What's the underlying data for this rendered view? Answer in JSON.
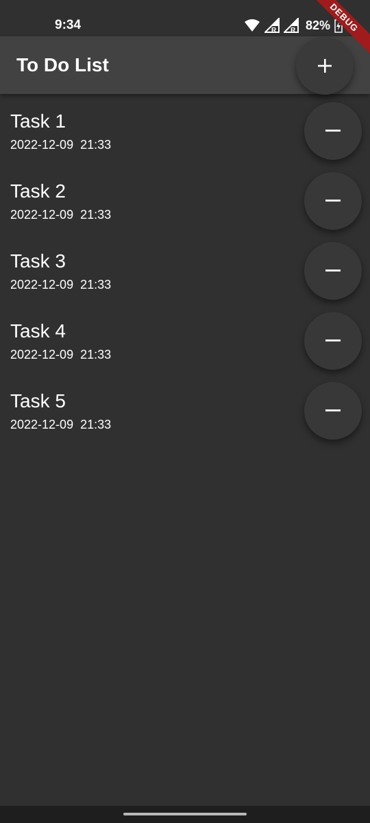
{
  "status_bar": {
    "time": "9:34",
    "battery": "82%",
    "icons": [
      "wifi-icon",
      "signal-r-icon",
      "signal-r-icon",
      "battery-charging-icon"
    ]
  },
  "debug_banner": "DEBUG",
  "app_bar": {
    "title": "To Do List",
    "add_button_icon": "plus-icon"
  },
  "tasks": [
    {
      "title": "Task 1",
      "date": "2022-12-09",
      "time": "21:33",
      "meta": "2022-12-09  21:33"
    },
    {
      "title": "Task 2",
      "date": "2022-12-09",
      "time": "21:33",
      "meta": "2022-12-09  21:33"
    },
    {
      "title": "Task 3",
      "date": "2022-12-09",
      "time": "21:33",
      "meta": "2022-12-09  21:33"
    },
    {
      "title": "Task 4",
      "date": "2022-12-09",
      "time": "21:33",
      "meta": "2022-12-09  21:33"
    },
    {
      "title": "Task 5",
      "date": "2022-12-09",
      "time": "21:33",
      "meta": "2022-12-09  21:33"
    }
  ],
  "remove_button_icon": "minus-icon",
  "colors": {
    "background": "#303030",
    "app_bar": "#424242",
    "fab": "#383838",
    "debug_ribbon": "#a01c1c",
    "text": "#ffffff"
  }
}
